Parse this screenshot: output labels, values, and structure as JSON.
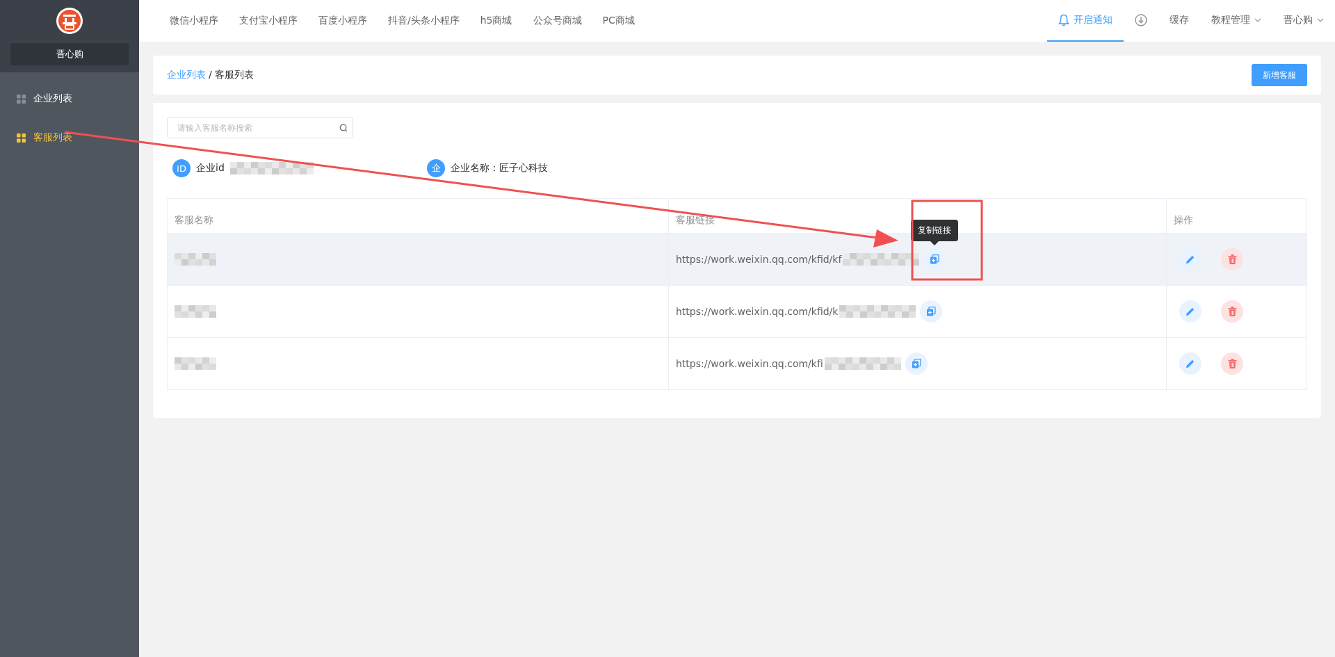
{
  "sidebar": {
    "brand": "晋心购",
    "items": [
      {
        "label": "企业列表",
        "selected": false
      },
      {
        "label": "客服列表",
        "selected": true
      }
    ]
  },
  "top_nav": {
    "links": [
      "微信小程序",
      "支付宝小程序",
      "百度小程序",
      "抖音/头条小程序",
      "h5商城",
      "公众号商城",
      "PC商城"
    ],
    "right": [
      {
        "kind": "bell",
        "label": "开启通知",
        "selected": true
      },
      {
        "kind": "download"
      },
      {
        "kind": "text",
        "label": "缓存"
      },
      {
        "kind": "dropdown",
        "label": "教程管理"
      },
      {
        "kind": "dropdown",
        "label": "晋心购"
      }
    ]
  },
  "breadcrumb": [
    {
      "kind": "link",
      "label": "企业列表"
    },
    {
      "kind": "current",
      "label": "/ 客服列表"
    }
  ],
  "add_button": "新增客服",
  "search": {
    "placeholder": "请输入客服名称搜索"
  },
  "info": [
    {
      "badge": "ID",
      "label": "企业id",
      "redacted": true
    },
    {
      "badge": "企",
      "label": "企业名称：匠子心科技",
      "redacted": false
    }
  ],
  "table": {
    "columns": [
      "客服名称",
      "客服链接",
      "操作"
    ],
    "rows": [
      {
        "hovered": true,
        "link": "https://work.weixin.qq.com/kfid/kf",
        "tooltip": "复制链接"
      },
      {
        "hovered": false,
        "link": "https://work.weixin.qq.com/kfid/k"
      },
      {
        "hovered": false,
        "link": "https://work.weixin.qq.com/kfi"
      }
    ]
  },
  "annotation": {
    "kind": "arrow_to_box"
  }
}
